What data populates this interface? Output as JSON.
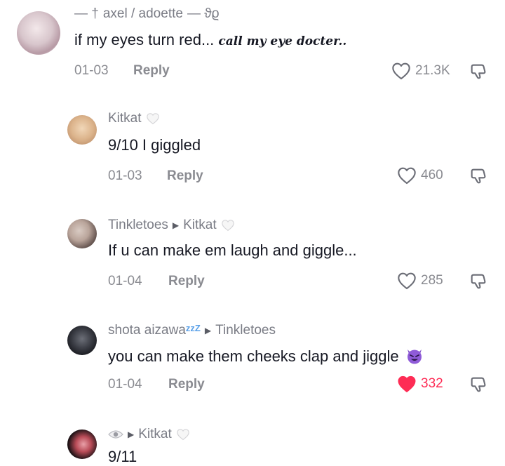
{
  "comments": [
    {
      "author": "axel / adoette",
      "author_prefix": "— †",
      "author_suffix": "— ϑϱ",
      "text": "if my eyes turn red...",
      "text_script": "call my eye docter..",
      "date": "01-03",
      "reply": "Reply",
      "likes": "21.3K",
      "liked": false
    },
    {
      "author": "Kitkat",
      "text": "9/10 I giggled",
      "date": "01-03",
      "reply": "Reply",
      "likes": "460",
      "liked": false
    },
    {
      "author": "Tinkletoes",
      "reply_to": "Kitkat",
      "text": "If u can make em laugh and giggle...",
      "date": "01-04",
      "reply": "Reply",
      "likes": "285",
      "liked": false
    },
    {
      "author": "shota aizawa",
      "author_sleep": "zzZ",
      "reply_to": "Tinkletoes",
      "text": "you can make them cheeks clap and jiggle",
      "emoji": "smiling-devil-emoji",
      "date": "01-04",
      "reply": "Reply",
      "likes": "332",
      "liked": true,
      "like_color": "#fe2c55"
    },
    {
      "author_icon": "eye-icon",
      "reply_to": "Kitkat",
      "text": "9/11"
    }
  ]
}
